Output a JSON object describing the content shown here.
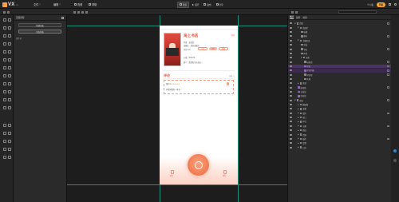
{
  "app": {
    "logo_text": "VX",
    "logo_sub": "ai"
  },
  "menu": [
    {
      "label": "文件"
    },
    {
      "label": "编辑"
    },
    {
      "label": "查看"
    },
    {
      "label": "帮助"
    }
  ],
  "toolbar": {
    "preview": "预览",
    "run": "运行",
    "publish": "发布",
    "share": "分享"
  },
  "user": {
    "upgrade": "升级",
    "badge": "个人版"
  },
  "left_panel": {
    "title": "页面管理",
    "buttons": [
      {
        "label": "新建页面"
      },
      {
        "label": "页面列表"
      }
    ],
    "section": "组件树"
  },
  "phone": {
    "book_title": "海上书店",
    "share": "分享",
    "meta": [
      "作者：某某某",
      "出版社：某某出版社",
      "评分 9.2",
      "价格：¥36.00",
      "简介：故事发生在海边…"
    ],
    "tags": [
      "小说",
      "文学",
      "经典"
    ],
    "section_title": "评论",
    "section_more": "更多 >",
    "comment_user": "用户A",
    "comment_stars": "★★★★★",
    "comment_text": "非常好看的一本书…",
    "tabs": [
      "首页",
      "我的"
    ]
  },
  "right_panel": {
    "tabs": [
      "图层",
      "组件",
      "资源"
    ],
    "layers": [
      {
        "label": "页面",
        "indent": 0,
        "arrow": "▼",
        "icon": "gray"
      },
      {
        "label": "顶部栏",
        "indent": 1,
        "arrow": "▼",
        "icon": "gray"
      },
      {
        "label": "标题",
        "indent": 2,
        "arrow": "",
        "icon": "gray"
      },
      {
        "label": "图标",
        "indent": 2,
        "arrow": "",
        "icon": "gray"
      },
      {
        "label": "书籍信息",
        "indent": 1,
        "arrow": "▼",
        "icon": "gray"
      },
      {
        "label": "封面",
        "indent": 2,
        "arrow": "",
        "icon": "gray"
      },
      {
        "label": "书名",
        "indent": 2,
        "arrow": "",
        "icon": "gray"
      },
      {
        "label": "作者",
        "indent": 2,
        "arrow": "",
        "icon": "gray"
      },
      {
        "label": "标签",
        "indent": 2,
        "arrow": "▼",
        "icon": "gray"
      },
      {
        "label": "标签项",
        "indent": 3,
        "arrow": "",
        "icon": "gray"
      },
      {
        "label": "评论",
        "indent": 3,
        "arrow": "",
        "icon": "purple",
        "state": "hl"
      },
      {
        "label": "评论列表",
        "indent": 3,
        "arrow": "",
        "icon": "purple",
        "state": "hl2"
      },
      {
        "label": "评论项",
        "indent": 3,
        "arrow": "",
        "icon": "gray"
      },
      {
        "label": "头像",
        "indent": 3,
        "arrow": "",
        "icon": "gray"
      },
      {
        "label": "底部",
        "indent": 1,
        "arrow": "▶",
        "icon": "gray"
      },
      {
        "label": "按钮组",
        "indent": 1,
        "arrow": "",
        "icon": "purple"
      },
      {
        "label": "主按钮",
        "indent": 1,
        "arrow": "",
        "icon": "purple"
      },
      {
        "label": "次按钮",
        "indent": 1,
        "arrow": "",
        "icon": "purple"
      },
      {
        "label": "全局",
        "indent": 0,
        "arrow": "▼",
        "icon": "gray"
      },
      {
        "label": "数据源",
        "indent": 1,
        "arrow": "▶",
        "icon": "gray"
      },
      {
        "label": "变量",
        "indent": 1,
        "arrow": "▶",
        "icon": "gray"
      },
      {
        "label": "事件",
        "indent": 1,
        "arrow": "▶",
        "icon": "gray"
      },
      {
        "label": "接口",
        "indent": 1,
        "arrow": "▶",
        "icon": "gray"
      },
      {
        "label": "样式",
        "indent": 1,
        "arrow": "▶",
        "icon": "gray"
      },
      {
        "label": "主题",
        "indent": 1,
        "arrow": "▶",
        "icon": "gray"
      },
      {
        "label": "路由",
        "indent": 1,
        "arrow": "▶",
        "icon": "gray"
      },
      {
        "label": "资源",
        "indent": 1,
        "arrow": "▶",
        "icon": "gray"
      },
      {
        "label": "插件",
        "indent": 1,
        "arrow": "▶",
        "icon": "gray"
      },
      {
        "label": "设置",
        "indent": 1,
        "arrow": "▶",
        "icon": "gray"
      },
      {
        "label": "日志",
        "indent": 1,
        "arrow": "▶",
        "icon": "gray"
      }
    ]
  },
  "colors": {
    "accent": "#f3a43a",
    "brand_red": "#e8543e",
    "guide": "#1f8f7a",
    "selection": "#4b3463"
  }
}
